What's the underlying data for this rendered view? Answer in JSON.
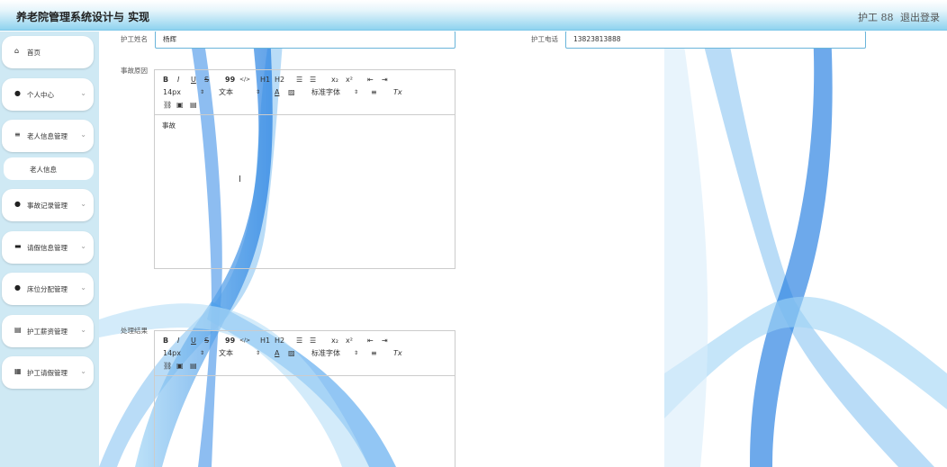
{
  "header": {
    "title": "养老院管理系统设计与 实现",
    "user": "护工 88",
    "logout": "退出登录"
  },
  "sidebar": {
    "items": [
      {
        "label": "首页",
        "icon": "home-icon"
      },
      {
        "label": "个人中心",
        "icon": "person-icon"
      },
      {
        "label": "老人信息管理",
        "icon": "list-icon"
      },
      {
        "label": "事故记录管理",
        "icon": "person-icon"
      },
      {
        "label": "请假信息管理",
        "icon": "message-icon"
      },
      {
        "label": "床位分配管理",
        "icon": "pin-icon"
      },
      {
        "label": "护工薪资管理",
        "icon": "document-icon"
      },
      {
        "label": "护工请假管理",
        "icon": "grid-icon"
      }
    ],
    "submenu": {
      "label": "老人信息"
    }
  },
  "form": {
    "nurse_name_label": "护工姓名",
    "nurse_name_value": "杨辉",
    "nurse_phone_label": "护工电话",
    "nurse_phone_value": "13823813888",
    "accident_reason_label": "事故原因",
    "accident_reason_content": "事故",
    "result_label": "处理结果"
  },
  "toolbar": {
    "bold": "B",
    "italic": "I",
    "underline": "U",
    "strike": "S",
    "quote": "99",
    "code": "</>",
    "h1": "H1",
    "h2": "H2",
    "sub": "x₂",
    "sup": "x²",
    "font_size": "14px",
    "text_type": "文本",
    "font_family": "标准字体",
    "clear": "Tx"
  }
}
